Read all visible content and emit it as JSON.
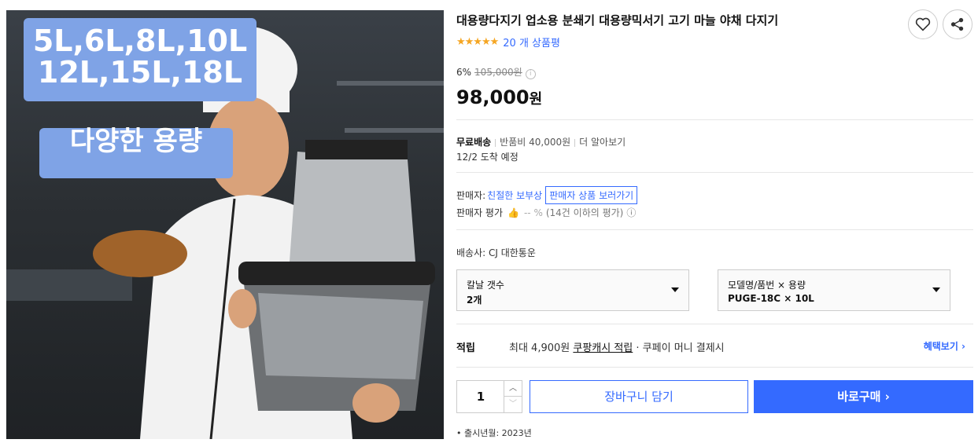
{
  "image": {
    "capacity_tag": "5L,6L,8L,10L\n12L,15L,18L",
    "capacity_line1": "5L,6L,8L,10L",
    "capacity_line2": "12L,15L,18L",
    "variety_tag": "다양한 용량"
  },
  "product": {
    "title": "대용량다지기 업소용 분쇄기 대용량믹서기 고기 마늘 야채 다지기",
    "stars": "★★★★★",
    "review_link": "20 개 상품평",
    "discount": "6%",
    "original_price": "105,000원",
    "price": "98,000",
    "price_unit": "원"
  },
  "shipping": {
    "free": "무료배송",
    "return_fee": "반품비 40,000원",
    "more": "더 알아보기",
    "arrival": "12/2 도착 예정"
  },
  "seller": {
    "label": "판매자:",
    "name": "친절한 보부상",
    "more": "판매자 상품 보러가기",
    "rating_label": "판매자 평가",
    "rating_value": "-- %",
    "rating_note": "(14건 이하의 평가)"
  },
  "carrier": "배송사:  CJ 대한통운",
  "options": [
    {
      "label": "칼날 갯수",
      "value": "2개"
    },
    {
      "label": "모델명/품번 × 용량",
      "value": "PUGE-18C × 10L"
    }
  ],
  "benefit": {
    "label": "적립",
    "text_prefix": "최대 4,900원 ",
    "text_link": "쿠팡캐시 적립",
    "text_suffix": " · 쿠페이 머니 결제시",
    "link": "혜택보기 ›"
  },
  "purchase": {
    "quantity": "1",
    "cart_label": "장바구니 담기",
    "buy_label": "바로구매  ›"
  },
  "release": "출시년월: 2023년"
}
